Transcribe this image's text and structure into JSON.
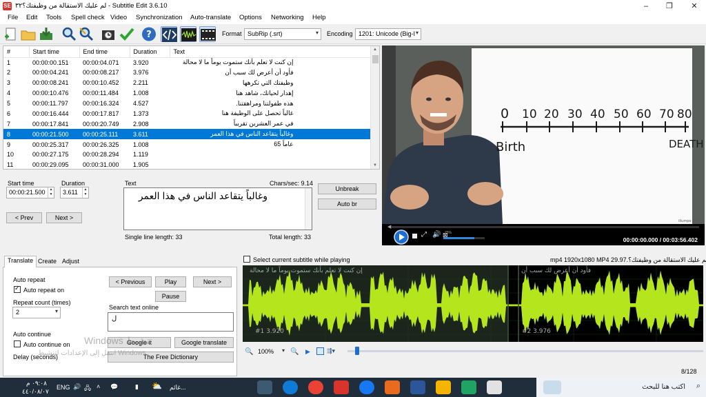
{
  "window": {
    "title": "لم عليك الاستقالة من وظيفتك؟٣٢ - Subtitle Edit 3.6.10",
    "app_icon": "SE",
    "controls": [
      "–",
      "❐",
      "✕"
    ]
  },
  "menu": [
    "File",
    "Edit",
    "Tools",
    "Spell check",
    "Video",
    "Synchronization",
    "Auto-translate",
    "Options",
    "Networking",
    "Help"
  ],
  "toolbar": {
    "icons": [
      "new-file-icon",
      "open-folder-icon",
      "save-icon",
      "find-icon",
      "replace-icon",
      "visual-sync-icon",
      "spell-check-icon",
      "help-icon",
      "source-view-icon",
      "waveform-toggle-icon",
      "video-toggle-icon"
    ],
    "format_label": "Format",
    "format_value": "SubRip (.srt)",
    "encoding_label": "Encoding",
    "encoding_value": "1201: Unicode (Big-I"
  },
  "grid": {
    "columns": [
      "#",
      "Start time",
      "End time",
      "Duration",
      "Text"
    ],
    "rows": [
      {
        "n": "1",
        "start": "00:00:00.151",
        "end": "00:00:04.071",
        "dur": "3.920",
        "text": "إن كنت لا تعلم بأنك ستموت يوماً ما لا محالة"
      },
      {
        "n": "2",
        "start": "00:00:04.241",
        "end": "00:00:08.217",
        "dur": "3.976",
        "text": "فأود أن أعرض لك سبب أن"
      },
      {
        "n": "3",
        "start": "00:00:08.241",
        "end": "00:00:10.452",
        "dur": "2.211",
        "text": "وظيفتك التي تكرهها"
      },
      {
        "n": "4",
        "start": "00:00:10.476",
        "end": "00:00:11.484",
        "dur": "1.008",
        "text": "إهدار لحياتك، شاهد هنا"
      },
      {
        "n": "5",
        "start": "00:00:11.797",
        "end": "00:00:16.324",
        "dur": "4.527",
        "text": "هذه طفولتنا ومراهقتنا."
      },
      {
        "n": "6",
        "start": "00:00:16.444",
        "end": "00:00:17.817",
        "dur": "1.373",
        "text": "غالباً تحصل على الوظيفة هنا"
      },
      {
        "n": "7",
        "start": "00:00:17.841",
        "end": "00:00:20.749",
        "dur": "2.908",
        "text": "في عمر العشرين تقريباً"
      },
      {
        "n": "8",
        "start": "00:00:21.500",
        "end": "00:00:25.111",
        "dur": "3.611",
        "text": "وغالباً يتقاعد الناس في هذا العمر"
      },
      {
        "n": "9",
        "start": "00:00:25.317",
        "end": "00:00:26.325",
        "dur": "1.008",
        "text": "عاماً 65"
      },
      {
        "n": "10",
        "start": "00:00:27.175",
        "end": "00:00:28.294",
        "dur": "1.119",
        "text": ""
      },
      {
        "n": "11",
        "start": "00:00:29.095",
        "end": "00:00:31.000",
        "dur": "1.905",
        "text": ""
      }
    ]
  },
  "editor": {
    "start_label": "Start time",
    "start_value": "00:00:21.500",
    "duration_label": "Duration",
    "duration_value": "3.611",
    "text_label": "Text",
    "chars_sec": "Chars/sec: 9.14",
    "text_value": "وغالباً يتقاعد الناس في هذا العمر",
    "single_line": "Single line length: 33",
    "total_length": "Total length: 33",
    "prev_label": "< Prev",
    "next_label": "Next >",
    "unbreak_label": "Unbreak",
    "autobr_label": "Auto br"
  },
  "video": {
    "board_numbers": [
      "0",
      "10",
      "20",
      "30",
      "40",
      "50",
      "60",
      "70",
      "80"
    ],
    "board_birth": "Birth",
    "board_death": "DEATH",
    "watermark": "illumpo 2.0",
    "volume": "75%",
    "time": "00:00:00.000 / 00:03:56.402"
  },
  "bottom": {
    "tabs": [
      "Translate",
      "Create",
      "Adjust"
    ],
    "auto_repeat_title": "Auto repeat",
    "auto_repeat_on": "Auto repeat on",
    "repeat_count_label": "Repeat count (times)",
    "repeat_count_value": "2",
    "auto_continue_title": "Auto continue",
    "auto_continue_on": "Auto continue on",
    "delay_label": "Delay (seconds)",
    "previous_label": "< Previous",
    "play_label": "Play",
    "next_label": "Next >",
    "pause_label": "Pause",
    "search_online_label": "Search text online",
    "search_value": "ل",
    "google_it": "Google it",
    "google_translate": "Google translate",
    "free_dictionary": "The Free Dictionary",
    "windows_activation_1": "Windows تنشيط",
    "windows_activation_2": "انتقل إلى الإعدادات لتنشيط Windows"
  },
  "waveform": {
    "select_current": "Select current subtitle while playing",
    "file_info": "لم عليك الاستقالة من وظيفتك؟.mp4 1920x1080 MP4 29.97",
    "seg1_text": "إن كنت لا تعلم بأنك ستموت يوماً ما لا محالة",
    "seg2_text": "فأود أن أعرض لك سبب أن",
    "seg1_label": "#1  3.920",
    "seg2_label": "#2  3.976",
    "zoom": "100%",
    "counter": "8/128"
  },
  "taskbar": {
    "clock_time": "٠٩:٠٨ م",
    "clock_date": "٤٤٠/٠٨/٠٧",
    "lang": "ENG",
    "weather": "غائم...",
    "search": "اكتب هنا للبحث"
  },
  "colors": {
    "selection": "#0078d7",
    "waveform": "#b5e61d",
    "waveform_selected": "#2b3d2b"
  }
}
